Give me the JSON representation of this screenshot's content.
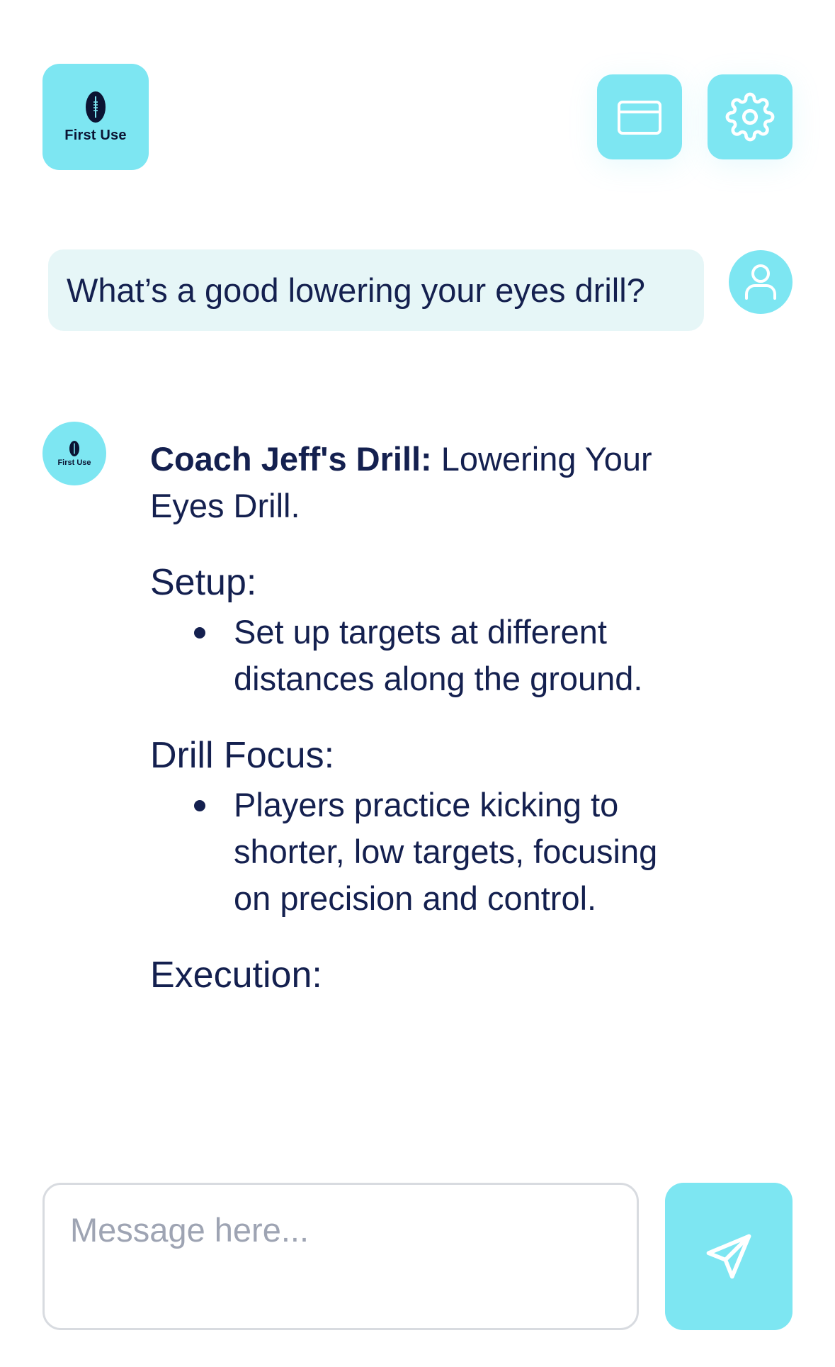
{
  "header": {
    "logo_text": "First Use",
    "folder_icon": "folder-icon",
    "settings_icon": "gear-icon"
  },
  "conversation": {
    "user_message": "What’s a good lowering your eyes drill?",
    "user_avatar_icon": "user-icon",
    "bot_avatar_text": "First Use",
    "bot": {
      "title_bold": "Coach Jeff's Drill:",
      "title_rest": " Lowering Your Eyes Drill.",
      "sections": [
        {
          "heading": "Setup:",
          "bullets": [
            "Set up targets at different distances along the ground."
          ]
        },
        {
          "heading": "Drill Focus:",
          "bullets": [
            "Players practice kicking to shorter, low targets, focusing on precision and control."
          ]
        },
        {
          "heading": "Execution:",
          "bullets": []
        }
      ]
    }
  },
  "composer": {
    "placeholder": "Message here...",
    "value": "",
    "send_icon": "send-icon"
  },
  "colors": {
    "accent": "#7de6f2",
    "user_bubble": "#e6f6f7",
    "text": "#14204f"
  }
}
